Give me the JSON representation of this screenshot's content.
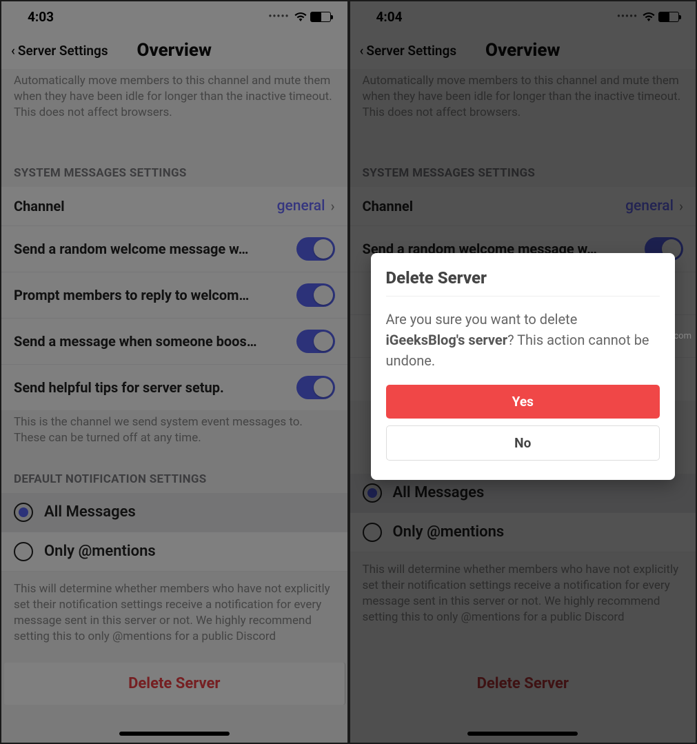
{
  "left": {
    "status_time": "4:03",
    "nav_back": "Server Settings",
    "nav_title": "Overview",
    "afk_help": "Automatically move members to this channel and mute them when they have been idle for longer than the inactive timeout. This does not affect browsers.",
    "sysmsg_header": "SYSTEM MESSAGES SETTINGS",
    "channel_label": "Channel",
    "channel_value": "general",
    "toggles": {
      "welcome": "Send a random welcome message w…",
      "prompt": "Prompt members to reply to welcom…",
      "boost": "Send a message when someone boos…",
      "tips": "Send helpful tips for server setup."
    },
    "sysmsg_help": "This is the channel we send system event messages to. These can be turned off at any time.",
    "notif_header": "DEFAULT NOTIFICATION SETTINGS",
    "notif_all": "All Messages",
    "notif_mentions": "Only @mentions",
    "notif_help": "This will determine whether members who have not explicitly set their notification settings receive a notification for every message sent in this server or not. We highly recommend setting this to only @mentions for a public Discord",
    "delete_label": "Delete Server"
  },
  "right": {
    "status_time": "4:04",
    "nav_back": "Server Settings",
    "nav_title": "Overview",
    "afk_help": "Automatically move members to this channel and mute them when they have been idle for longer than the inactive timeout. This does not affect browsers.",
    "sysmsg_header": "SYSTEM MESSAGES SETTINGS",
    "channel_label": "Channel",
    "channel_value": "general",
    "toggles": {
      "welcome": "Send a random welcome message w…"
    },
    "notif_all": "All Messages",
    "notif_mentions": "Only @mentions",
    "notif_help": "This will determine whether members who have not explicitly set their notification settings receive a notification for every message sent in this server or not. We highly recommend setting this to only @mentions for a public Discord",
    "delete_label": "Delete Server",
    "modal": {
      "title": "Delete Server",
      "body_prefix": "Are you sure you want to delete ",
      "body_bold": "iGeeksBlog's server",
      "body_suffix": "? This action cannot be undone.",
      "yes": "Yes",
      "no": "No"
    }
  },
  "watermark": "www.deuaq.com"
}
